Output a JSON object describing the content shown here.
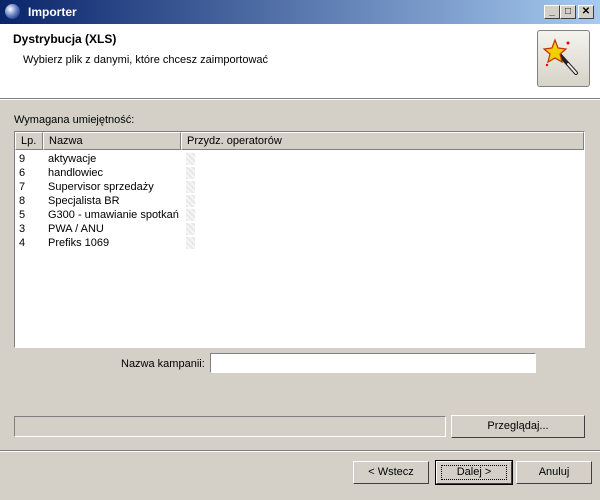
{
  "window": {
    "title": "Importer",
    "controls": {
      "minimize": "_",
      "maximize": "□",
      "close": "✕"
    }
  },
  "header": {
    "title": "Dystrybucja (XLS)",
    "description": "Wybierz plik z danymi, które chcesz zaimportować",
    "icon": "magic-wand-icon"
  },
  "skills_label": "Wymagana umiejętność:",
  "table": {
    "columns": [
      "Lp.",
      "Nazwa",
      "Przydz. operatorów"
    ],
    "rows": [
      {
        "lp": "9",
        "name": "aktywacje"
      },
      {
        "lp": "6",
        "name": "handlowiec"
      },
      {
        "lp": "7",
        "name": "Supervisor sprzedaży"
      },
      {
        "lp": "8",
        "name": "Specjalista BR"
      },
      {
        "lp": "5",
        "name": "G300 - umawianie spotkań"
      },
      {
        "lp": "3",
        "name": "PWA / ANU"
      },
      {
        "lp": "4",
        "name": "Prefiks 1069"
      }
    ]
  },
  "campaign": {
    "label": "Nazwa kampanii:",
    "value": ""
  },
  "buttons": {
    "browse": "Przeglądaj...",
    "back": "< Wstecz",
    "next": "Dalej >",
    "cancel": "Anuluj"
  }
}
